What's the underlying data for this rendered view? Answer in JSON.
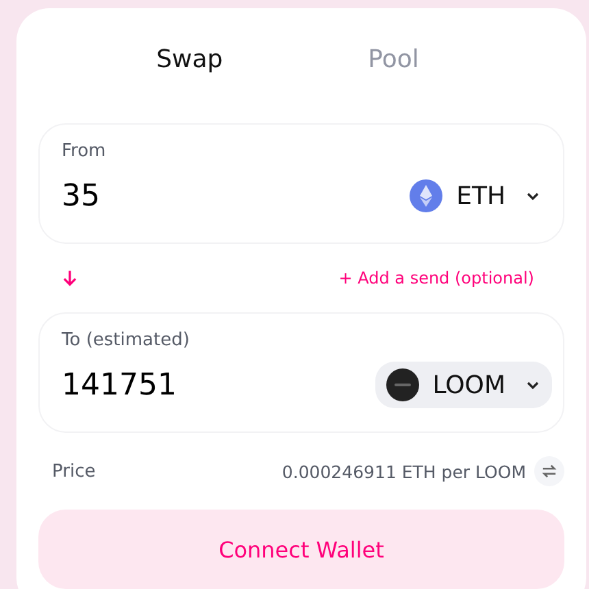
{
  "tabs": [
    {
      "label": "Swap",
      "selected": true
    },
    {
      "label": "Pool",
      "selected": false
    }
  ],
  "from": {
    "label": "From",
    "value": "35",
    "token": {
      "symbol": "ETH",
      "kind": "eth",
      "highlighted": false
    }
  },
  "add_send": "+ Add a send (optional)",
  "to": {
    "label": "To (estimated)",
    "value": "141751",
    "token": {
      "symbol": "LOOM",
      "kind": "loom",
      "highlighted": true
    }
  },
  "price": {
    "label": "Price",
    "value": "0.000246911 ETH per LOOM"
  },
  "button": "Connect Wallet"
}
